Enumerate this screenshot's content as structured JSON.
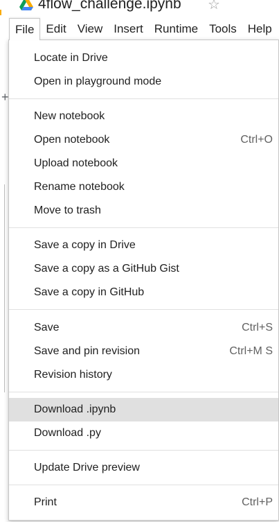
{
  "notebook": {
    "title": "4flow_challenge.ipynb"
  },
  "menubar": {
    "items": [
      "File",
      "Edit",
      "View",
      "Insert",
      "Runtime",
      "Tools",
      "Help"
    ]
  },
  "file_menu": {
    "items": [
      {
        "label": "Locate in Drive",
        "shortcut": ""
      },
      {
        "label": "Open in playground mode",
        "shortcut": ""
      },
      {
        "label": "New notebook",
        "shortcut": ""
      },
      {
        "label": "Open notebook",
        "shortcut": "Ctrl+O"
      },
      {
        "label": "Upload notebook",
        "shortcut": ""
      },
      {
        "label": "Rename notebook",
        "shortcut": ""
      },
      {
        "label": "Move to trash",
        "shortcut": ""
      },
      {
        "label": "Save a copy in Drive",
        "shortcut": ""
      },
      {
        "label": "Save a copy as a GitHub Gist",
        "shortcut": ""
      },
      {
        "label": "Save a copy in GitHub",
        "shortcut": ""
      },
      {
        "label": "Save",
        "shortcut": "Ctrl+S"
      },
      {
        "label": "Save and pin revision",
        "shortcut": "Ctrl+M S"
      },
      {
        "label": "Revision history",
        "shortcut": ""
      },
      {
        "label": "Download .ipynb",
        "shortcut": "",
        "highlighted": true
      },
      {
        "label": "Download .py",
        "shortcut": ""
      },
      {
        "label": "Update Drive preview",
        "shortcut": ""
      },
      {
        "label": "Print",
        "shortcut": "Ctrl+P"
      }
    ]
  },
  "icons": {
    "drive": "google-drive-icon",
    "star": "star-outline-icon",
    "add": "plus-icon"
  },
  "colors": {
    "highlight": "#e0e0e0",
    "drive_yellow": "#f9ab00",
    "drive_green": "#0f9d58",
    "drive_blue": "#4285f4"
  }
}
